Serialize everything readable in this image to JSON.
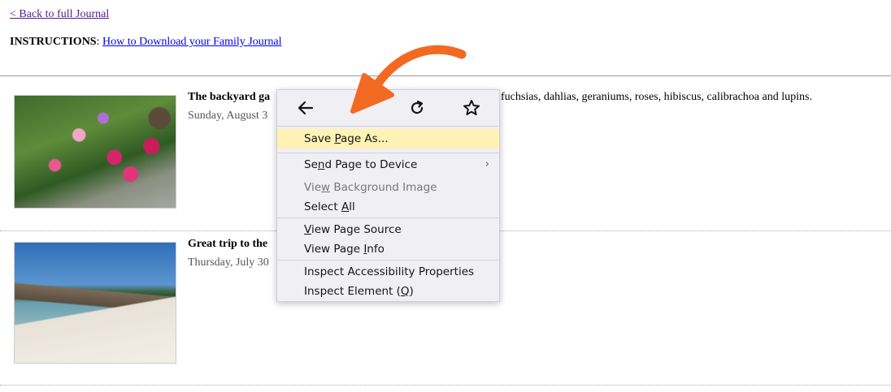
{
  "nav": {
    "back_link": "< Back to full Journal"
  },
  "instructions": {
    "label": "INSTRUCTIONS",
    "sep": ": ",
    "link": "How to Download your Family Journal"
  },
  "entries": [
    {
      "title": "The backyard ga",
      "date": "Sunday, August 3",
      "rest": "fuchsias, dahlias, geraniums, roses, hibiscus, calibrachoa and lupins."
    },
    {
      "title": "Great trip to the",
      "date": "Thursday, July 30"
    }
  ],
  "context_menu": {
    "nav_icons": [
      "back-arrow-icon",
      "reload-icon",
      "bookmark-star-icon"
    ],
    "items": [
      {
        "pre": "Save ",
        "acc": "P",
        "post": "age As..."
      },
      {
        "pre": "Se",
        "acc": "n",
        "post": "d Page to Device",
        "chevron": "›"
      },
      {
        "pre": "Vie",
        "acc": "w",
        "post": " Background Image"
      },
      {
        "pre": "Select ",
        "acc": "A",
        "post": "ll"
      },
      {
        "pre": "",
        "acc": "V",
        "post": "iew Page Source"
      },
      {
        "pre": "View Page ",
        "acc": "I",
        "post": "nfo"
      },
      {
        "pre": "Inspect Accessibility Properties",
        "acc": "",
        "post": ""
      },
      {
        "pre": "Inspect Element (",
        "acc": "Q",
        "post": ")"
      }
    ]
  },
  "colors": {
    "highlight": "#fff2b3",
    "arrow": "#f26a21",
    "link": "#0000ee"
  }
}
